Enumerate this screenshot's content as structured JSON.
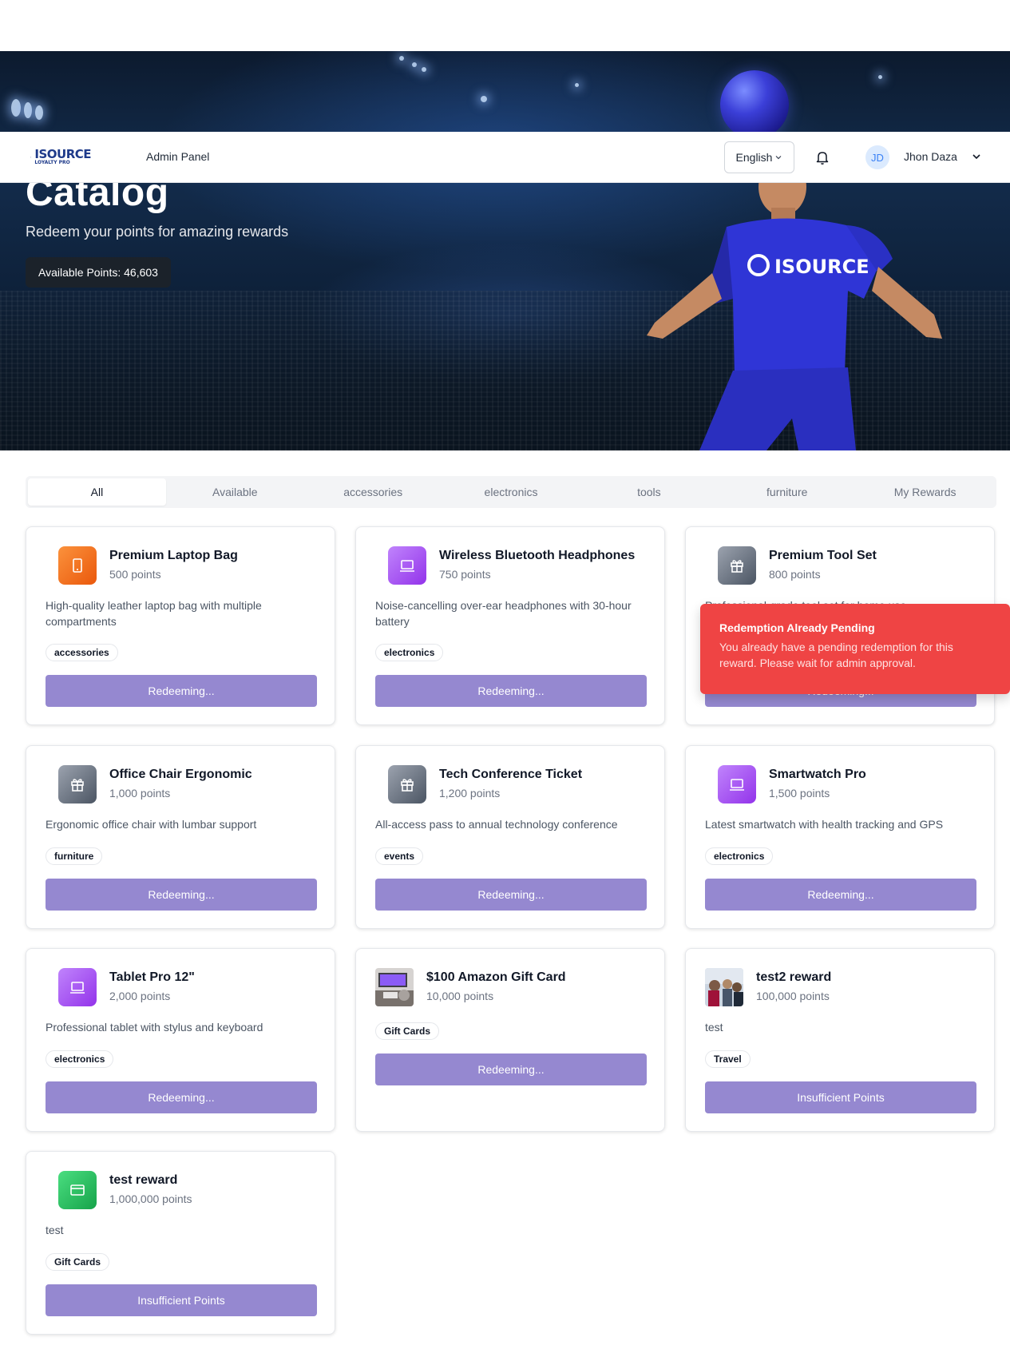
{
  "header": {
    "admin_link": "Admin Panel",
    "language": "English",
    "user_initials": "JD",
    "user_name": "Jhon Daza"
  },
  "hero": {
    "title": "Catalog",
    "subtitle": "Redeem your points for amazing rewards",
    "available_points": "Available Points: 46,603",
    "shirt_brand": "ISOURCE"
  },
  "logo": {
    "text": "ISOURCE",
    "subtext": "LOYALTY PRO"
  },
  "tabs": [
    "All",
    "Available",
    "accessories",
    "electronics",
    "tools",
    "furniture",
    "My Rewards"
  ],
  "rewards": [
    {
      "title": "Premium Laptop Bag",
      "points": "500 points",
      "description": "High-quality leather laptop bag with multiple compartments",
      "tag": "accessories",
      "button": "Redeeming...",
      "icon": "phone-icon",
      "color": "#f97316"
    },
    {
      "title": "Wireless Bluetooth Headphones",
      "points": "750 points",
      "description": "Noise-cancelling over-ear headphones with 30-hour battery",
      "tag": "electronics",
      "button": "Redeeming...",
      "icon": "laptop-icon",
      "color": "#a855f7"
    },
    {
      "title": "Premium Tool Set",
      "points": "800 points",
      "description": "Professional-grade tool set for home use",
      "tag": "tools",
      "button": "Redeeming...",
      "icon": "gift-icon",
      "color": "#6b7280"
    },
    {
      "title": "Office Chair Ergonomic",
      "points": "1,000 points",
      "description": "Ergonomic office chair with lumbar support",
      "tag": "furniture",
      "button": "Redeeming...",
      "icon": "gift-icon",
      "color": "#6b7280"
    },
    {
      "title": "Tech Conference Ticket",
      "points": "1,200 points",
      "description": "All-access pass to annual technology conference",
      "tag": "events",
      "button": "Redeeming...",
      "icon": "gift-icon",
      "color": "#6b7280"
    },
    {
      "title": "Smartwatch Pro",
      "points": "1,500 points",
      "description": "Latest smartwatch with health tracking and GPS",
      "tag": "electronics",
      "button": "Redeeming...",
      "icon": "laptop-icon",
      "color": "#a855f7"
    },
    {
      "title": "Tablet Pro 12\"",
      "points": "2,000 points",
      "description": "Professional tablet with stylus and keyboard",
      "tag": "electronics",
      "button": "Redeeming...",
      "icon": "laptop-icon",
      "color": "#a855f7"
    },
    {
      "title": "$100 Amazon Gift Card",
      "points": "10,000 points",
      "description": "",
      "tag": "Gift Cards",
      "button": "Redeeming...",
      "icon": "photo-thumbnail",
      "color": "#6b7280"
    },
    {
      "title": "test2 reward",
      "points": "100,000 points",
      "description": "test",
      "tag": "Travel",
      "button": "Insufficient Points",
      "icon": "photo-thumbnail",
      "color": "#6b7280"
    },
    {
      "title": "test reward",
      "points": "1,000,000 points",
      "description": "test",
      "tag": "Gift Cards",
      "button": "Insufficient Points",
      "icon": "credit-card-icon",
      "color": "#22c55e"
    }
  ],
  "toast": {
    "title": "Redemption Already Pending",
    "message": "You already have a pending redemption for this reward. Please wait for admin approval."
  },
  "colors": {
    "button": "#9588d0",
    "toast": "#ef4444",
    "accent": "#3b82f6"
  }
}
